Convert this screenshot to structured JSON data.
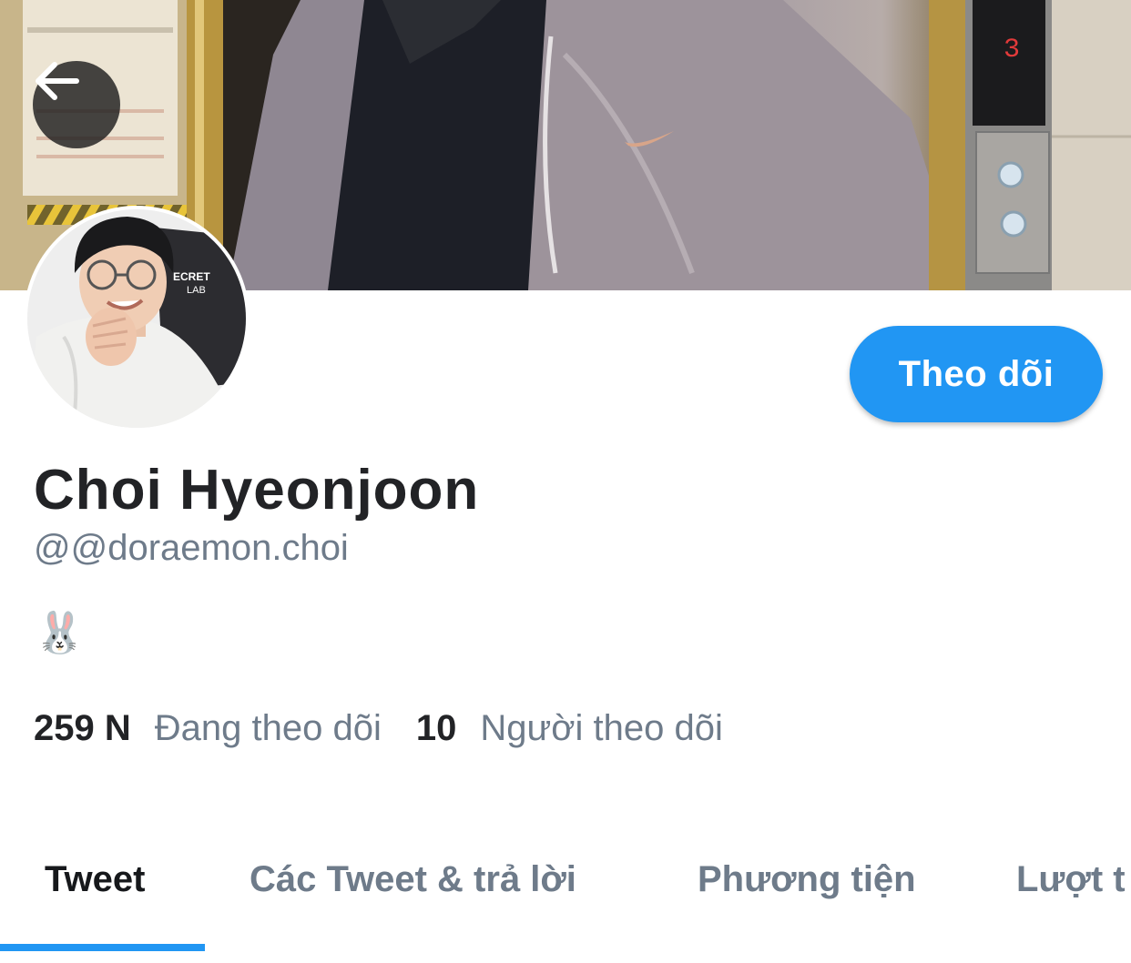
{
  "profile": {
    "display_name": "Choi Hyeonjoon",
    "handle": "@@doraemon.choi",
    "bio_emoji": "🐰"
  },
  "actions": {
    "follow_label": "Theo dõi"
  },
  "stats": {
    "following_count": "259 N",
    "following_label": "Đang theo dõi",
    "followers_count": "10",
    "followers_label": "Người theo dõi"
  },
  "tabs": [
    {
      "label": "Tweet",
      "active": true
    },
    {
      "label": "Các Tweet & trả lời",
      "active": false
    },
    {
      "label": "Phương tiện",
      "active": false
    },
    {
      "label": "Lượt t",
      "active": false
    }
  ],
  "banner": {
    "elevator_display": "3"
  },
  "colors": {
    "accent": "#2196f3",
    "name_text": "#222326",
    "secondary_text": "#6e7b8a"
  }
}
